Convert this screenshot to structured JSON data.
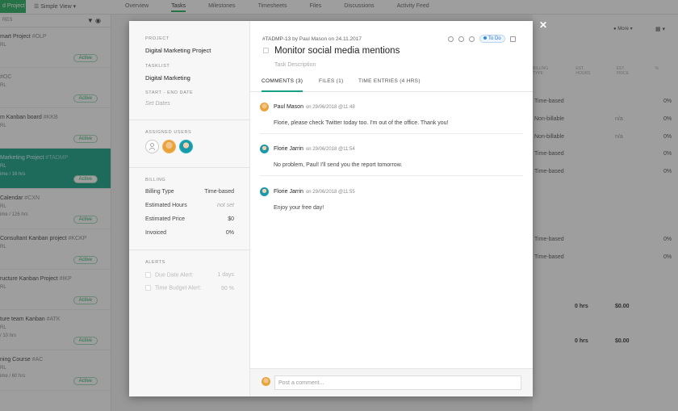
{
  "background": {
    "new_project": "d Project",
    "view": "Simple View",
    "tabs": [
      "Overview",
      "Tasks",
      "Milestones",
      "Timesheets",
      "Files",
      "Discussions",
      "Activity Feed"
    ],
    "sidebar_head": "RES",
    "projects": [
      {
        "title": "mart Project",
        "code": "#OLP",
        "sub": "RL",
        "sub2": "",
        "badge": "Active"
      },
      {
        "title": "",
        "code": "#OC",
        "sub": "RL",
        "sub2": "",
        "badge": "Active"
      },
      {
        "title": "m Kanban board",
        "code": "#KKB",
        "sub": "RL",
        "sub2": "",
        "badge": "Active"
      },
      {
        "title": "Marketing Project",
        "code": "#TADMP",
        "sub": "RL",
        "sub2": "ime / 16 hrs",
        "badge": "Active"
      },
      {
        "title": "Calendar",
        "code": "#CXN",
        "sub": "RL",
        "sub2": "ime / 126 hrs",
        "badge": "Active"
      },
      {
        "title": "Consultant Kanban project",
        "code": "#KCKP",
        "sub": "RL",
        "sub2": "",
        "badge": "Active"
      },
      {
        "title": "ructure Kanban Project",
        "code": "#IKP",
        "sub": "RL",
        "sub2": "",
        "badge": "Active"
      },
      {
        "title": "ture team Kanban",
        "code": "#ATK",
        "sub": "RL",
        "sub2": "/ 10 hrs",
        "badge": "Active"
      },
      {
        "title": "ning Course",
        "code": "#AC",
        "sub": "RL",
        "sub2": "ime / 60 hrs",
        "badge": "Active"
      }
    ],
    "right_tools": "More",
    "right_cols": [
      "BILLING TYPE",
      "EST. HOURS",
      "EST. PRICE",
      "%"
    ],
    "right_rows": [
      {
        "type": "Time-based",
        "na": "",
        "pct": "0%"
      },
      {
        "type": "Non-billable",
        "na": "n/a",
        "pct": "0%"
      },
      {
        "type": "Non-billable",
        "na": "n/a",
        "pct": "0%"
      },
      {
        "type": "Time-based",
        "na": "",
        "pct": "0%"
      },
      {
        "type": "Time-based",
        "na": "",
        "pct": "0%"
      },
      {
        "type": "Time-based",
        "na": "",
        "pct": "0%"
      },
      {
        "type": "Time-based",
        "na": "",
        "pct": "0%"
      }
    ],
    "totals": [
      {
        "hrs": "0 hrs",
        "price": "$0.00"
      },
      {
        "hrs": "0 hrs",
        "price": "$0.00"
      }
    ]
  },
  "modal": {
    "left": {
      "project_label": "PROJECT",
      "project": "Digital Marketing Project",
      "tasklist_label": "TASKLIST",
      "tasklist": "Digital Marketing",
      "dates_label": "START - END DATE",
      "dates_placeholder": "Set Dates",
      "users_label": "ASSIGNED USERS",
      "billing_label": "BILLING",
      "billing": [
        {
          "k": "Billing Type",
          "v": "Time-based"
        },
        {
          "k": "Estimated Hours",
          "v": "not set"
        },
        {
          "k": "Estimated Price",
          "v": "$0"
        },
        {
          "k": "Invoiced",
          "v": "0%"
        }
      ],
      "alerts_label": "ALERTS",
      "alerts": [
        {
          "k": "Due Date Alert:",
          "v": "1 days"
        },
        {
          "k": "Time Budget Alert:",
          "v": "90 %"
        }
      ]
    },
    "main": {
      "task_id": "#TADMP-13",
      "meta_by": "by Paul Mason on 24.11.2017",
      "status": "To Do",
      "title": "Monitor social media mentions",
      "description": "Task Description",
      "tabs": [
        "COMMENTS (3)",
        "FILES (1)",
        "TIME ENTRIES (4 HRS)"
      ],
      "comments": [
        {
          "name": "Paul Mason",
          "date": "on 29/06/2018 @11:48",
          "body": "Florie, please check Twitter today too. I'm out of the office. Thank you!"
        },
        {
          "name": "Florie Jarrin",
          "date": "on 29/06/2018 @11:54",
          "body": "No problem, Paul! I'll send you the report tomorrow."
        },
        {
          "name": "Florie Jarrin",
          "date": "on 29/06/2018 @11:55",
          "body": "Enjoy your free day!"
        }
      ],
      "comment_placeholder": "Post a comment..."
    }
  }
}
